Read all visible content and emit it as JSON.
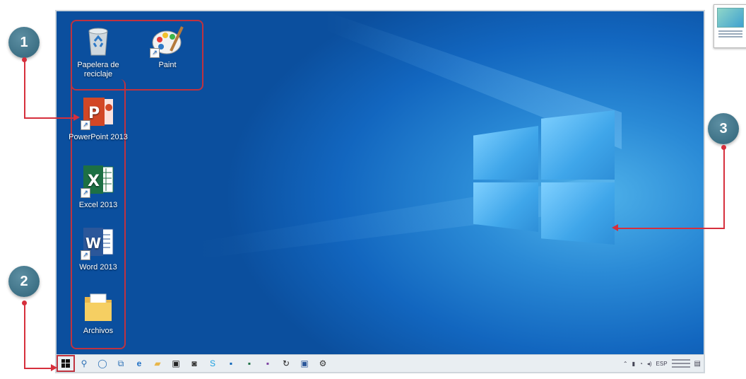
{
  "desktop": {
    "icons": [
      {
        "label": "Papelera de reciclaje",
        "icon": "recycle-bin-icon"
      },
      {
        "label": "Paint",
        "icon": "paint-icon"
      },
      {
        "label": "PowerPoint 2013",
        "icon": "powerpoint-icon"
      },
      {
        "label": "Excel 2013",
        "icon": "excel-icon"
      },
      {
        "label": "Word 2013",
        "icon": "word-icon"
      },
      {
        "label": "Archivos",
        "icon": "folder-icon"
      }
    ]
  },
  "callouts": [
    {
      "number": "1"
    },
    {
      "number": "2"
    },
    {
      "number": "3"
    }
  ],
  "taskbar": {
    "tray_language": "ESP"
  },
  "colors": {
    "accent_red": "#d62f3c",
    "badge": "#3d7389",
    "desktop_blue": "#1266bf"
  }
}
